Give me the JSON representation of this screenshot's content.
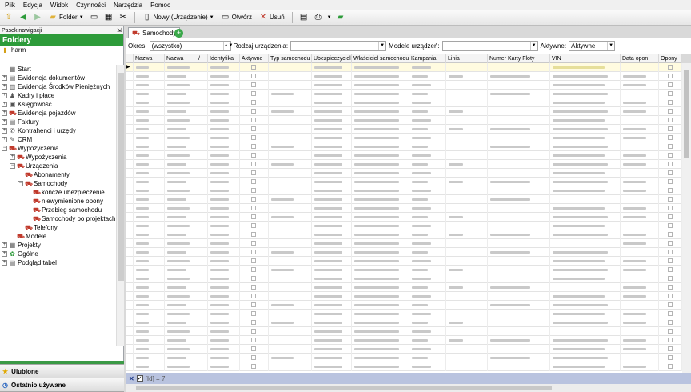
{
  "menu": [
    "Plik",
    "Edycja",
    "Widok",
    "Czynności",
    "Narzędzia",
    "Pomoc"
  ],
  "toolbar": {
    "folder_label": "Folder",
    "new_label": "Nowy (Urządzenie)",
    "open_label": "Otwórz",
    "delete_label": "Usuń"
  },
  "nav": {
    "panel_title": "Pasek nawigacji",
    "folders_header": "Foldery",
    "root": "harm",
    "tree": [
      {
        "label": "Start",
        "level": 0,
        "expander": "",
        "icon": "start-icon",
        "glyph": "▦"
      },
      {
        "label": "Ewidencja dokumentów",
        "level": 0,
        "expander": "+",
        "icon": "documents-icon",
        "glyph": "▤"
      },
      {
        "label": "Ewidencja Środków Pieniężnych",
        "level": 0,
        "expander": "+",
        "icon": "money-icon",
        "glyph": "▥"
      },
      {
        "label": "Kadry i płace",
        "level": 0,
        "expander": "+",
        "icon": "people-icon",
        "glyph": "♟"
      },
      {
        "label": "Księgowość",
        "level": 0,
        "expander": "+",
        "icon": "ledger-icon",
        "glyph": "▣"
      },
      {
        "label": "Ewidencja pojazdów",
        "level": 0,
        "expander": "+",
        "icon": "car-icon",
        "glyph": "⛟"
      },
      {
        "label": "Faktury",
        "level": 0,
        "expander": "+",
        "icon": "invoice-icon",
        "glyph": "▤"
      },
      {
        "label": "Kontrahenci i urzędy",
        "level": 0,
        "expander": "+",
        "icon": "contractors-icon",
        "glyph": "✆"
      },
      {
        "label": "CRM",
        "level": 0,
        "expander": "+",
        "icon": "crm-icon",
        "glyph": "✎"
      },
      {
        "label": "Wypożyczenia",
        "level": 0,
        "expander": "−",
        "icon": "car-icon",
        "glyph": "⛟"
      },
      {
        "label": "Wypożyczenia",
        "level": 1,
        "expander": "+",
        "icon": "car-icon",
        "glyph": "⛟"
      },
      {
        "label": "Urządzenia",
        "level": 1,
        "expander": "−",
        "icon": "car-icon",
        "glyph": "⛟"
      },
      {
        "label": "Abonamenty",
        "level": 2,
        "expander": "",
        "icon": "car-icon",
        "glyph": "⛟"
      },
      {
        "label": "Samochody",
        "level": 2,
        "expander": "−",
        "icon": "car-icon",
        "glyph": "⛟"
      },
      {
        "label": "koncze ubezpieczenie",
        "level": 3,
        "expander": "",
        "icon": "car-icon",
        "glyph": "⛟"
      },
      {
        "label": "niewymienione opony",
        "level": 3,
        "expander": "",
        "icon": "car-icon",
        "glyph": "⛟"
      },
      {
        "label": "Przebieg samochodu",
        "level": 3,
        "expander": "",
        "icon": "car-icon",
        "glyph": "⛟"
      },
      {
        "label": "Samochody po projektach",
        "level": 3,
        "expander": "",
        "icon": "car-icon",
        "glyph": "⛟"
      },
      {
        "label": "Telefony",
        "level": 2,
        "expander": "",
        "icon": "car-icon",
        "glyph": "⛟"
      },
      {
        "label": "Modele",
        "level": 1,
        "expander": "",
        "icon": "car-icon",
        "glyph": "⛟"
      },
      {
        "label": "Projekty",
        "level": 0,
        "expander": "+",
        "icon": "projects-icon",
        "glyph": "▦"
      },
      {
        "label": "Ogólne",
        "level": 0,
        "expander": "+",
        "icon": "general-icon",
        "glyph": "✿"
      },
      {
        "label": "Podgląd tabel",
        "level": 0,
        "expander": "+",
        "icon": "tables-icon",
        "glyph": "▤"
      }
    ],
    "bottom": [
      {
        "label": "Ulubione",
        "icon": "star-icon",
        "glyph": "★"
      },
      {
        "label": "Ostatnio używane",
        "icon": "recent-icon",
        "glyph": "◷"
      },
      {
        "label": "Foldery",
        "icon": "folder-icon",
        "glyph": "▰"
      }
    ]
  },
  "tab": {
    "label": "Samochody"
  },
  "filters": {
    "okres_label": "Okres:",
    "okres_value": "(wszystko)",
    "rodzaj_label": "Rodzaj urządzenia:",
    "rodzaj_value": "",
    "modele_label": "Modele urządzeń:",
    "modele_value": "",
    "aktywne_label": "Aktywne:",
    "aktywne_value": "Aktywne"
  },
  "grid": {
    "columns": [
      "",
      "Nazwa",
      "Nazwa",
      "Identyfika",
      "Aktywne",
      "Typ samochodu",
      "Ubezpieczyciel",
      "Właściciel samochodu",
      "Kampania",
      "Linia",
      "Numer Karty Floty",
      "VIN",
      "Data opon",
      "Opony"
    ],
    "sort_mark": "/",
    "row_count": 35
  },
  "status": {
    "text": "[Id] = 7"
  },
  "colors": {
    "accent_green": "#2d9b3a",
    "selected_yellow": "#f3a31b",
    "status_blue": "#b9c3df"
  }
}
